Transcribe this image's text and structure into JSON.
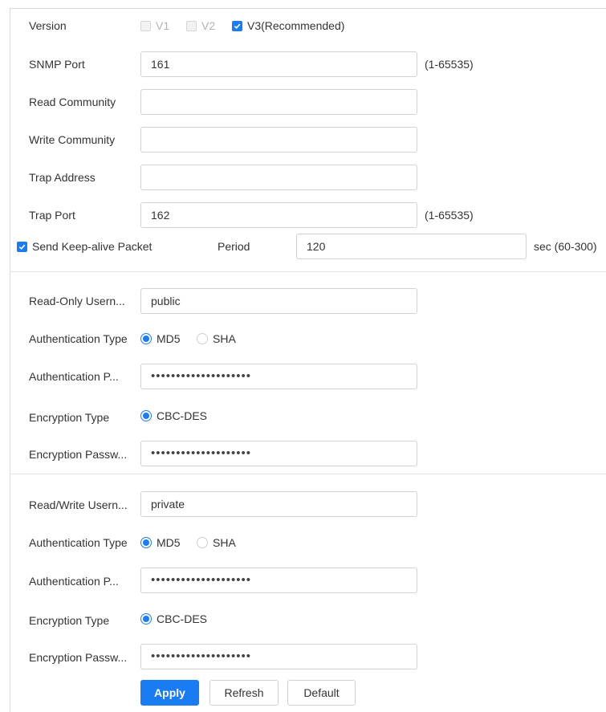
{
  "colors": {
    "accent": "#1a7cf2",
    "border": "#d2d2d2"
  },
  "version": {
    "label": "Version",
    "options": [
      {
        "label": "V1",
        "checked": false,
        "disabled": true
      },
      {
        "label": "V2",
        "checked": false,
        "disabled": true
      },
      {
        "label": "V3(Recommended)",
        "checked": true,
        "disabled": false
      }
    ]
  },
  "snmp_port": {
    "label": "SNMP Port",
    "value": "161",
    "range": "(1-65535)"
  },
  "read_community": {
    "label": "Read Community",
    "value": ""
  },
  "write_community": {
    "label": "Write Community",
    "value": ""
  },
  "trap_address": {
    "label": "Trap Address",
    "value": ""
  },
  "trap_port": {
    "label": "Trap Port",
    "value": "162",
    "range": "(1-65535)"
  },
  "keepalive": {
    "label": "Send Keep-alive Packet",
    "checked": true,
    "period_label": "Period",
    "period_value": "120",
    "unit": "sec (60-300)"
  },
  "read_only": {
    "username_label": "Read-Only Usern...",
    "username": "public",
    "auth_type_label": "Authentication Type",
    "auth_options": [
      "MD5",
      "SHA"
    ],
    "auth_selected": "MD5",
    "auth_password_label": "Authentication P...",
    "auth_password": "••••••••••••••••••••",
    "enc_type_label": "Encryption Type",
    "enc_option": "CBC-DES",
    "enc_password_label": "Encryption Passw...",
    "enc_password": "••••••••••••••••••••"
  },
  "read_write": {
    "username_label": "Read/Write Usern...",
    "username": "private",
    "auth_type_label": "Authentication Type",
    "auth_options": [
      "MD5",
      "SHA"
    ],
    "auth_selected": "MD5",
    "auth_password_label": "Authentication P...",
    "auth_password": "••••••••••••••••••••",
    "enc_type_label": "Encryption Type",
    "enc_option": "CBC-DES",
    "enc_password_label": "Encryption Passw...",
    "enc_password": "••••••••••••••••••••"
  },
  "buttons": {
    "apply": "Apply",
    "refresh": "Refresh",
    "default": "Default"
  }
}
